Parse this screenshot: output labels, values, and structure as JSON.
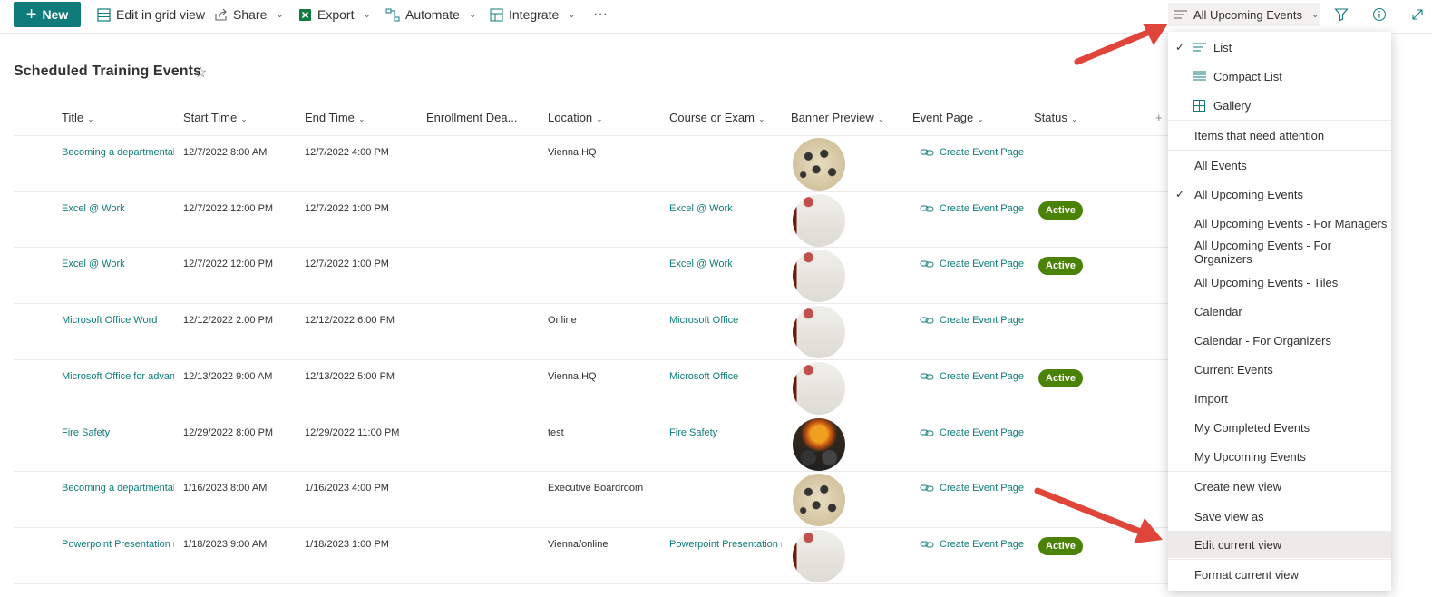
{
  "toolbar": {
    "new_label": "New",
    "edit_grid_label": "Edit in grid view",
    "share_label": "Share",
    "export_label": "Export",
    "automate_label": "Automate",
    "integrate_label": "Integrate",
    "more_label": "···",
    "current_view_label": "All Upcoming Events"
  },
  "page": {
    "title": "Scheduled Training Events"
  },
  "columns": [
    "Title",
    "Start Time",
    "End Time",
    "Enrollment Dea...",
    "Location",
    "Course or Exam",
    "Banner Preview",
    "Event Page",
    "Status"
  ],
  "rows": [
    {
      "title": "Becoming a departmental",
      "start": "12/7/2022 8:00 AM",
      "end": "12/7/2022 4:00 PM",
      "location": "Vienna HQ",
      "course": "",
      "thumb": "people",
      "event_page": "Create Event Page",
      "status": ""
    },
    {
      "title": "Excel @ Work",
      "start": "12/7/2022 12:00 PM",
      "end": "12/7/2022 1:00 PM",
      "location": "",
      "course": "Excel @ Work",
      "thumb": "excel",
      "event_page": "Create Event Page",
      "status": "Active"
    },
    {
      "title": "Excel @ Work",
      "start": "12/7/2022 12:00 PM",
      "end": "12/7/2022 1:00 PM",
      "location": "",
      "course": "Excel @ Work",
      "thumb": "excel",
      "event_page": "Create Event Page",
      "status": "Active"
    },
    {
      "title": "Microsoft Office Word",
      "start": "12/12/2022 2:00 PM",
      "end": "12/12/2022 6:00 PM",
      "location": "Online",
      "course": "Microsoft Office",
      "thumb": "excel",
      "event_page": "Create Event Page",
      "status": ""
    },
    {
      "title": "Microsoft Office for advan",
      "start": "12/13/2022 9:00 AM",
      "end": "12/13/2022 5:00 PM",
      "location": "Vienna HQ",
      "course": "Microsoft Office",
      "thumb": "excel",
      "event_page": "Create Event Page",
      "status": "Active"
    },
    {
      "title": "Fire Safety",
      "start": "12/29/2022 8:00 PM",
      "end": "12/29/2022 11:00 PM",
      "location": "test",
      "course": "Fire Safety",
      "thumb": "fire",
      "event_page": "Create Event Page",
      "status": ""
    },
    {
      "title": "Becoming a departmental",
      "start": "1/16/2023 8:00 AM",
      "end": "1/16/2023 4:00 PM",
      "location": "Executive Boardroom",
      "course": "",
      "thumb": "people",
      "event_page": "Create Event Page",
      "status": ""
    },
    {
      "title": "Powerpoint Presentation r",
      "start": "1/18/2023 9:00 AM",
      "end": "1/18/2023 1:00 PM",
      "location": "Vienna/online",
      "course": "Powerpoint Presentation r",
      "thumb": "excel",
      "event_page": "Create Event Page",
      "status": "Active"
    }
  ],
  "view_menu": {
    "layouts": [
      "List",
      "Compact List",
      "Gallery"
    ],
    "attention": "Items that need attention",
    "views": [
      "All Events",
      "All Upcoming Events",
      "All Upcoming Events - For Managers",
      "All Upcoming Events - For Organizers",
      "All Upcoming Events - Tiles",
      "Calendar",
      "Calendar - For Organizers",
      "Current Events",
      "Import",
      "My Completed Events",
      "My Upcoming Events"
    ],
    "actions": [
      "Create new view",
      "Save view as",
      "Edit current view",
      "Format current view"
    ]
  },
  "colors": {
    "accent": "#0f7b7b",
    "status_active": "#498205",
    "annotation_arrow": "#e0453a"
  }
}
